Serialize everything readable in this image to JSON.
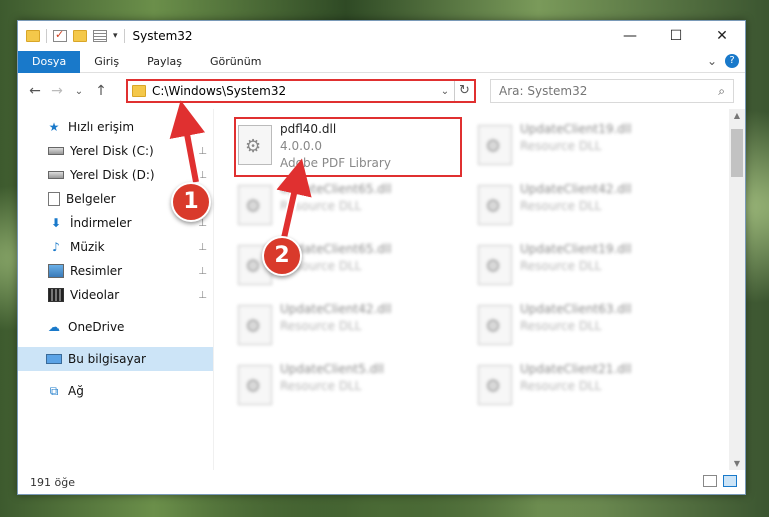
{
  "window": {
    "title": "System32",
    "controls": {
      "minimize": "—",
      "maximize": "☐",
      "close": "✕"
    }
  },
  "ribbon": {
    "tabs": [
      "Dosya",
      "Giriş",
      "Paylaş",
      "Görünüm"
    ],
    "active_tab": "Dosya",
    "expand": "⌄",
    "help": "?"
  },
  "nav": {
    "back": "←",
    "forward": "→",
    "recent": "⌄",
    "up": "↑",
    "address_path": "C:\\Windows\\System32",
    "dropdown": "⌄",
    "refresh": "↻",
    "search_placeholder": "Ara: System32",
    "search_icon": "⌕"
  },
  "sidebar": {
    "items": [
      {
        "label": "Hızlı erişim",
        "icon": "star-icon",
        "glyph": "★",
        "pinned": false,
        "level": "top"
      },
      {
        "label": "Yerel Disk (C:)",
        "icon": "disk-icon",
        "glyph": "",
        "pinned": true,
        "level": "sub"
      },
      {
        "label": "Yerel Disk (D:)",
        "icon": "disk-icon",
        "glyph": "",
        "pinned": true,
        "level": "sub"
      },
      {
        "label": "Belgeler",
        "icon": "document-icon",
        "glyph": "",
        "pinned": true,
        "level": "sub"
      },
      {
        "label": "İndirmeler",
        "icon": "download-icon",
        "glyph": "⬇",
        "pinned": true,
        "level": "sub"
      },
      {
        "label": "Müzik",
        "icon": "music-icon",
        "glyph": "♪",
        "pinned": true,
        "level": "sub"
      },
      {
        "label": "Resimler",
        "icon": "pictures-icon",
        "glyph": "",
        "pinned": true,
        "level": "sub"
      },
      {
        "label": "Videolar",
        "icon": "videos-icon",
        "glyph": "",
        "pinned": true,
        "level": "sub"
      },
      {
        "label": "OneDrive",
        "icon": "cloud-icon",
        "glyph": "☁",
        "pinned": false,
        "level": "top"
      },
      {
        "label": "Bu bilgisayar",
        "icon": "computer-icon",
        "glyph": "",
        "pinned": false,
        "level": "top",
        "selected": true
      },
      {
        "label": "Ağ",
        "icon": "network-icon",
        "glyph": "⧉",
        "pinned": false,
        "level": "top"
      }
    ],
    "pin_glyph": "📌"
  },
  "files": [
    {
      "name": "pdfl40.dll",
      "line2": "4.0.0.0",
      "line3": "Adobe PDF Library",
      "highlight": true
    },
    {
      "name": "UpdateClient19.dll",
      "line2": "Resource DLL",
      "highlight": false
    },
    {
      "name": "UpdateClient65.dll",
      "line2": "Resource DLL",
      "highlight": false
    },
    {
      "name": "UpdateClient42.dll",
      "line2": "Resource DLL",
      "highlight": false
    },
    {
      "name": "UpdateClient65.dll",
      "line2": "Resource DLL",
      "highlight": false
    },
    {
      "name": "UpdateClient19.dll",
      "line2": "Resource DLL",
      "highlight": false
    },
    {
      "name": "UpdateClient42.dll",
      "line2": "Resource DLL",
      "highlight": false
    },
    {
      "name": "UpdateClient63.dll",
      "line2": "Resource DLL",
      "highlight": false
    },
    {
      "name": "UpdateClient5.dll",
      "line2": "Resource DLL",
      "highlight": false
    },
    {
      "name": "UpdateClient21.dll",
      "line2": "Resource DLL",
      "highlight": false
    }
  ],
  "status": {
    "count": "191 öğe"
  },
  "callouts": [
    "1",
    "2"
  ],
  "colors": {
    "accent": "#1979ca",
    "annotation": "#e03030",
    "selected": "#cce4f7"
  }
}
